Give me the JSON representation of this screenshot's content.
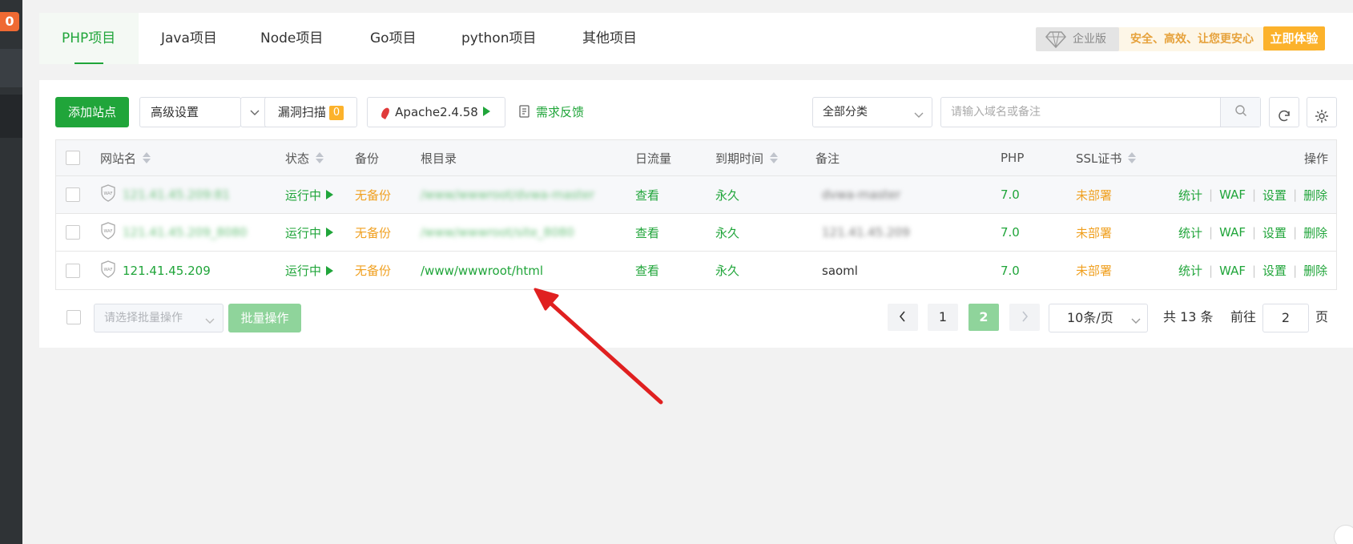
{
  "sidebar": {
    "badge": "0"
  },
  "tabs": [
    {
      "label": "PHP项目",
      "active": true
    },
    {
      "label": "Java项目"
    },
    {
      "label": "Node项目"
    },
    {
      "label": "Go项目"
    },
    {
      "label": "python项目"
    },
    {
      "label": "其他项目"
    }
  ],
  "enterprise": {
    "tag": "企业版",
    "slogan": "安全、高效、让您更安心",
    "button": "立即体验",
    "colors": {
      "accent": "#fcb22b",
      "text": "#e6a23c"
    }
  },
  "toolbar": {
    "add_site": "添加站点",
    "advanced": "高级设置",
    "vuln_scan": "漏洞扫描",
    "vuln_count": "0",
    "apache": "Apache2.4.58",
    "feedback": "需求反馈",
    "category": "全部分类",
    "search_placeholder": "请输入域名或备注"
  },
  "table": {
    "headers": {
      "name": "网站名",
      "status": "状态",
      "backup": "备份",
      "root": "根目录",
      "traffic": "日流量",
      "expire": "到期时间",
      "remark": "备注",
      "php": "PHP",
      "ssl": "SSL证书",
      "ops": "操作"
    },
    "rows": [
      {
        "name": "121.41.45.209:81",
        "status": "运行中",
        "backup": "无备份",
        "root": "/www/wwwroot/dvwa-master",
        "traffic": "查看",
        "expire": "永久",
        "remark": "dvwa-master",
        "php": "7.0",
        "ssl": "未部署"
      },
      {
        "name": "121.41.45.209_8080",
        "status": "运行中",
        "backup": "无备份",
        "root": "/www/wwwroot/site_8080",
        "traffic": "查看",
        "expire": "永久",
        "remark": "121.41.45.209",
        "php": "7.0",
        "ssl": "未部署"
      },
      {
        "name": "121.41.45.209",
        "status": "运行中",
        "backup": "无备份",
        "root": "/www/wwwroot/html",
        "traffic": "查看",
        "expire": "永久",
        "remark": "saoml",
        "php": "7.0",
        "ssl": "未部署"
      }
    ],
    "ops": {
      "stats": "统计",
      "waf": "WAF",
      "settings": "设置",
      "delete": "删除"
    },
    "waf_icon_label": "WAF"
  },
  "footer": {
    "batch_placeholder": "请选择批量操作",
    "batch_button": "批量操作",
    "pages": [
      "1",
      "2"
    ],
    "current_page": "2",
    "page_size": "10条/页",
    "total": "共 13 条",
    "goto_prefix": "前往",
    "goto_value": "2",
    "goto_suffix": "页"
  },
  "colors": {
    "brand_green": "#20a53a",
    "warning_orange": "#f0a020",
    "annotation_arrow": "#e02020"
  }
}
